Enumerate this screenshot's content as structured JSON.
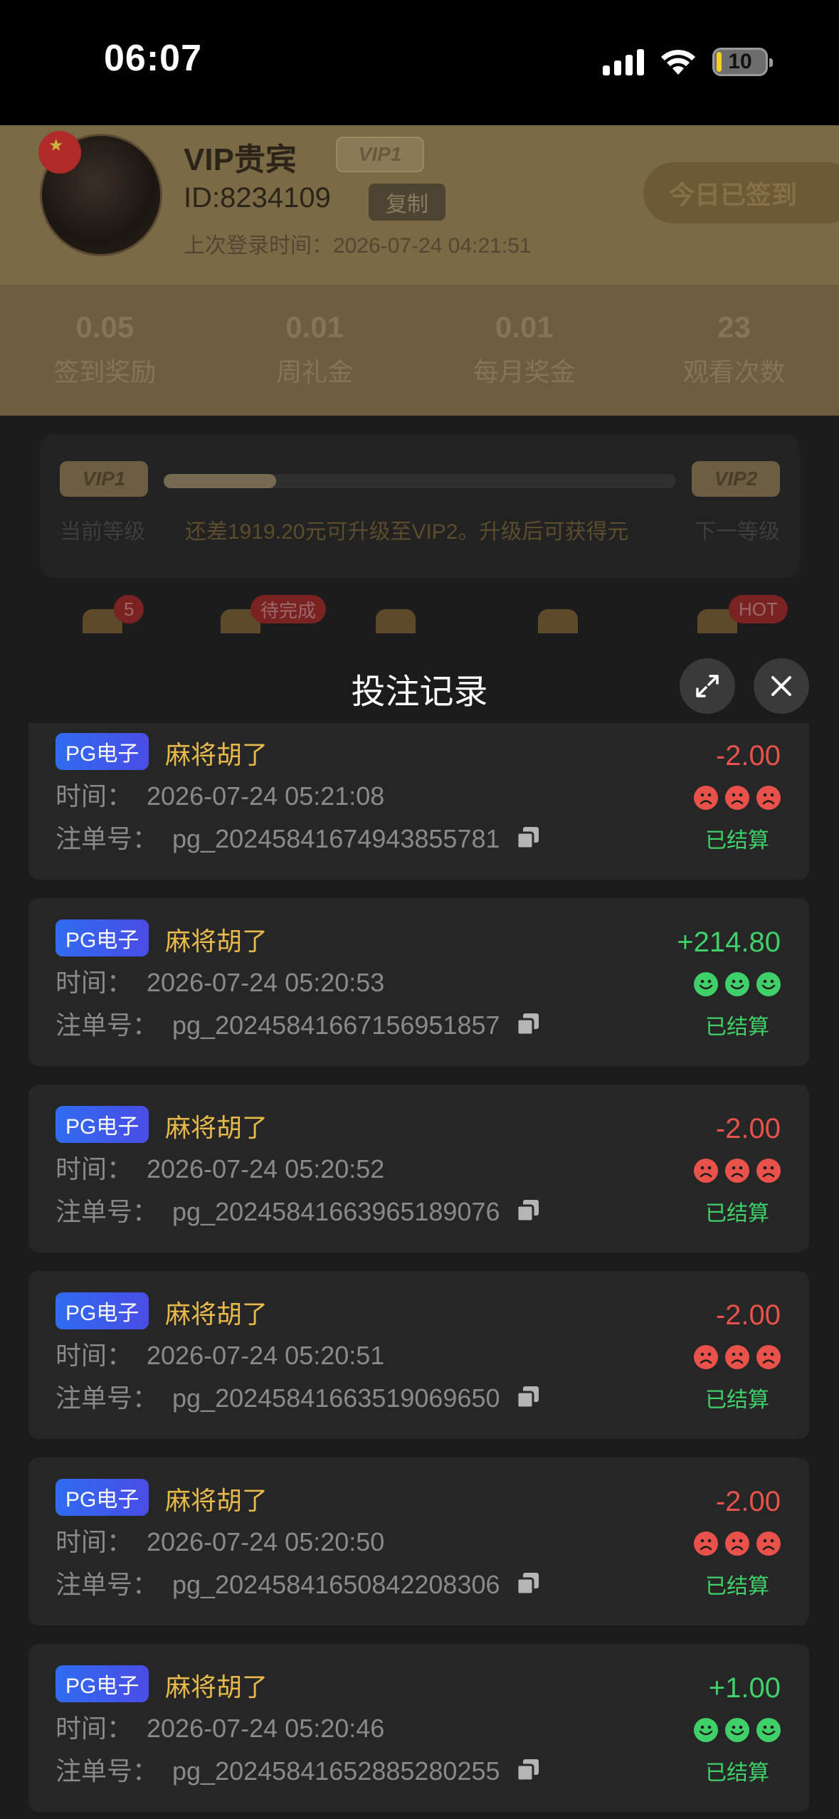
{
  "status_bar": {
    "time": "06:07",
    "battery": "10",
    "battery_level": 0.1
  },
  "background": {
    "vip_name": "VIP贵宾",
    "vip_badge": "VIP1",
    "user_id": "ID:8234109",
    "copy_label": "复制",
    "last_login": "上次登录时间：2026-07-24 04:21:51",
    "signin_label": "今日已签到",
    "stats": [
      {
        "value": "0.05",
        "label": "签到奖励"
      },
      {
        "value": "0.01",
        "label": "周礼金"
      },
      {
        "value": "0.01",
        "label": "每月奖金"
      },
      {
        "value": "23",
        "label": "观看次数"
      }
    ],
    "level": {
      "current_badge": "VIP1",
      "next_badge": "VIP2",
      "current_label": "当前等级",
      "next_label": "下一等级",
      "message": "还差1919.20元可升级至VIP2。升级后可获得元",
      "progress": 0.22
    },
    "quick_badges": [
      "5",
      "待完成",
      "HOT"
    ]
  },
  "sheet": {
    "title": "投注记录",
    "records": [
      {
        "tag": "PG电子",
        "game": "麻将胡了",
        "time_label": "时间：",
        "time": "2026-07-24 05:21:08",
        "order_label": "注单号：",
        "order": "pg_20245841674943855781",
        "amount": "-2.00",
        "result": "loss",
        "status": "已结算"
      },
      {
        "tag": "PG电子",
        "game": "麻将胡了",
        "time_label": "时间：",
        "time": "2026-07-24 05:20:53",
        "order_label": "注单号：",
        "order": "pg_20245841667156951857",
        "amount": "+214.80",
        "result": "win",
        "status": "已结算"
      },
      {
        "tag": "PG电子",
        "game": "麻将胡了",
        "time_label": "时间：",
        "time": "2026-07-24 05:20:52",
        "order_label": "注单号：",
        "order": "pg_20245841663965189076",
        "amount": "-2.00",
        "result": "loss",
        "status": "已结算"
      },
      {
        "tag": "PG电子",
        "game": "麻将胡了",
        "time_label": "时间：",
        "time": "2026-07-24 05:20:51",
        "order_label": "注单号：",
        "order": "pg_20245841663519069650",
        "amount": "-2.00",
        "result": "loss",
        "status": "已结算"
      },
      {
        "tag": "PG电子",
        "game": "麻将胡了",
        "time_label": "时间：",
        "time": "2026-07-24 05:20:50",
        "order_label": "注单号：",
        "order": "pg_20245841650842208306",
        "amount": "-2.00",
        "result": "loss",
        "status": "已结算"
      },
      {
        "tag": "PG电子",
        "game": "麻将胡了",
        "time_label": "时间：",
        "time": "2026-07-24 05:20:46",
        "order_label": "注单号：",
        "order": "pg_20245841652885280255",
        "amount": "+1.00",
        "result": "win",
        "status": "已结算"
      }
    ]
  },
  "colors": {
    "loss": "#e8524a",
    "win": "#3fd06a",
    "game_name": "#e7b94a",
    "tag_start": "#2f6cf0",
    "tag_end": "#4a4ce6"
  }
}
